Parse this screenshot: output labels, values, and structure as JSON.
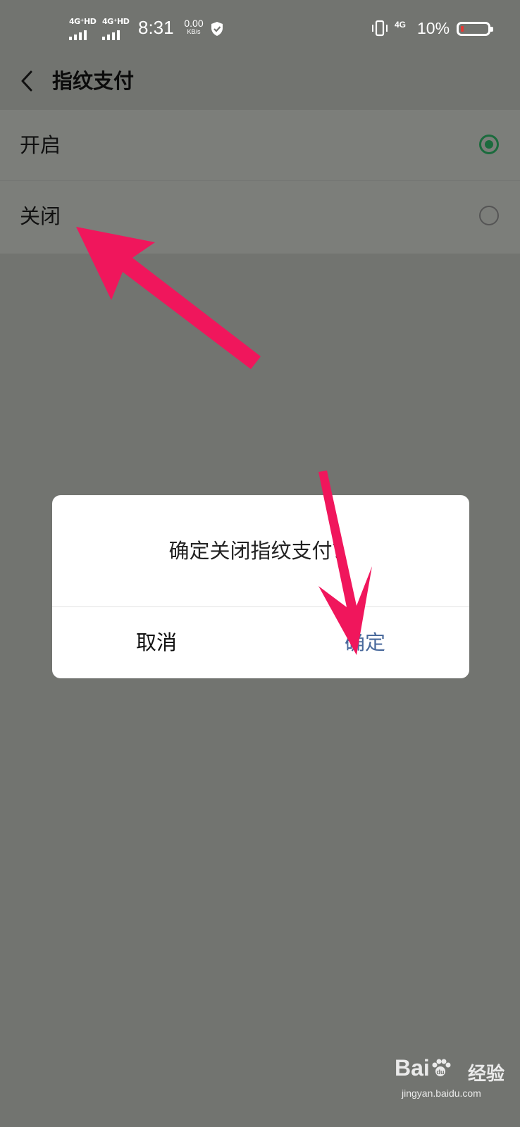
{
  "status_bar": {
    "sim1_network": "4G⁺HD",
    "sim2_network": "4G⁺HD",
    "time": "8:31",
    "net_speed_value": "0.00",
    "net_speed_unit": "KB/s",
    "right_network": "4G",
    "battery_percent": "10%",
    "battery_level": 0.1,
    "battery_level_color": "#e53935"
  },
  "app_bar": {
    "back_icon": "chevron-left-icon",
    "title": "指纹支付"
  },
  "options": [
    {
      "label": "开启",
      "selected": true
    },
    {
      "label": "关闭",
      "selected": false
    }
  ],
  "dialog": {
    "message": "确定关闭指纹支付？",
    "cancel_label": "取消",
    "confirm_label": "确定"
  },
  "watermark": {
    "logo_text": "Bai",
    "logo_text2": "经验",
    "url": "jingyan.baidu.com"
  },
  "colors": {
    "scrim_background": "#727470",
    "list_background": "#7c7e7a",
    "selected_radio": "#1b6b3d",
    "confirm_text": "#4a6a9c",
    "annotation_arrow": "#f0165c"
  }
}
